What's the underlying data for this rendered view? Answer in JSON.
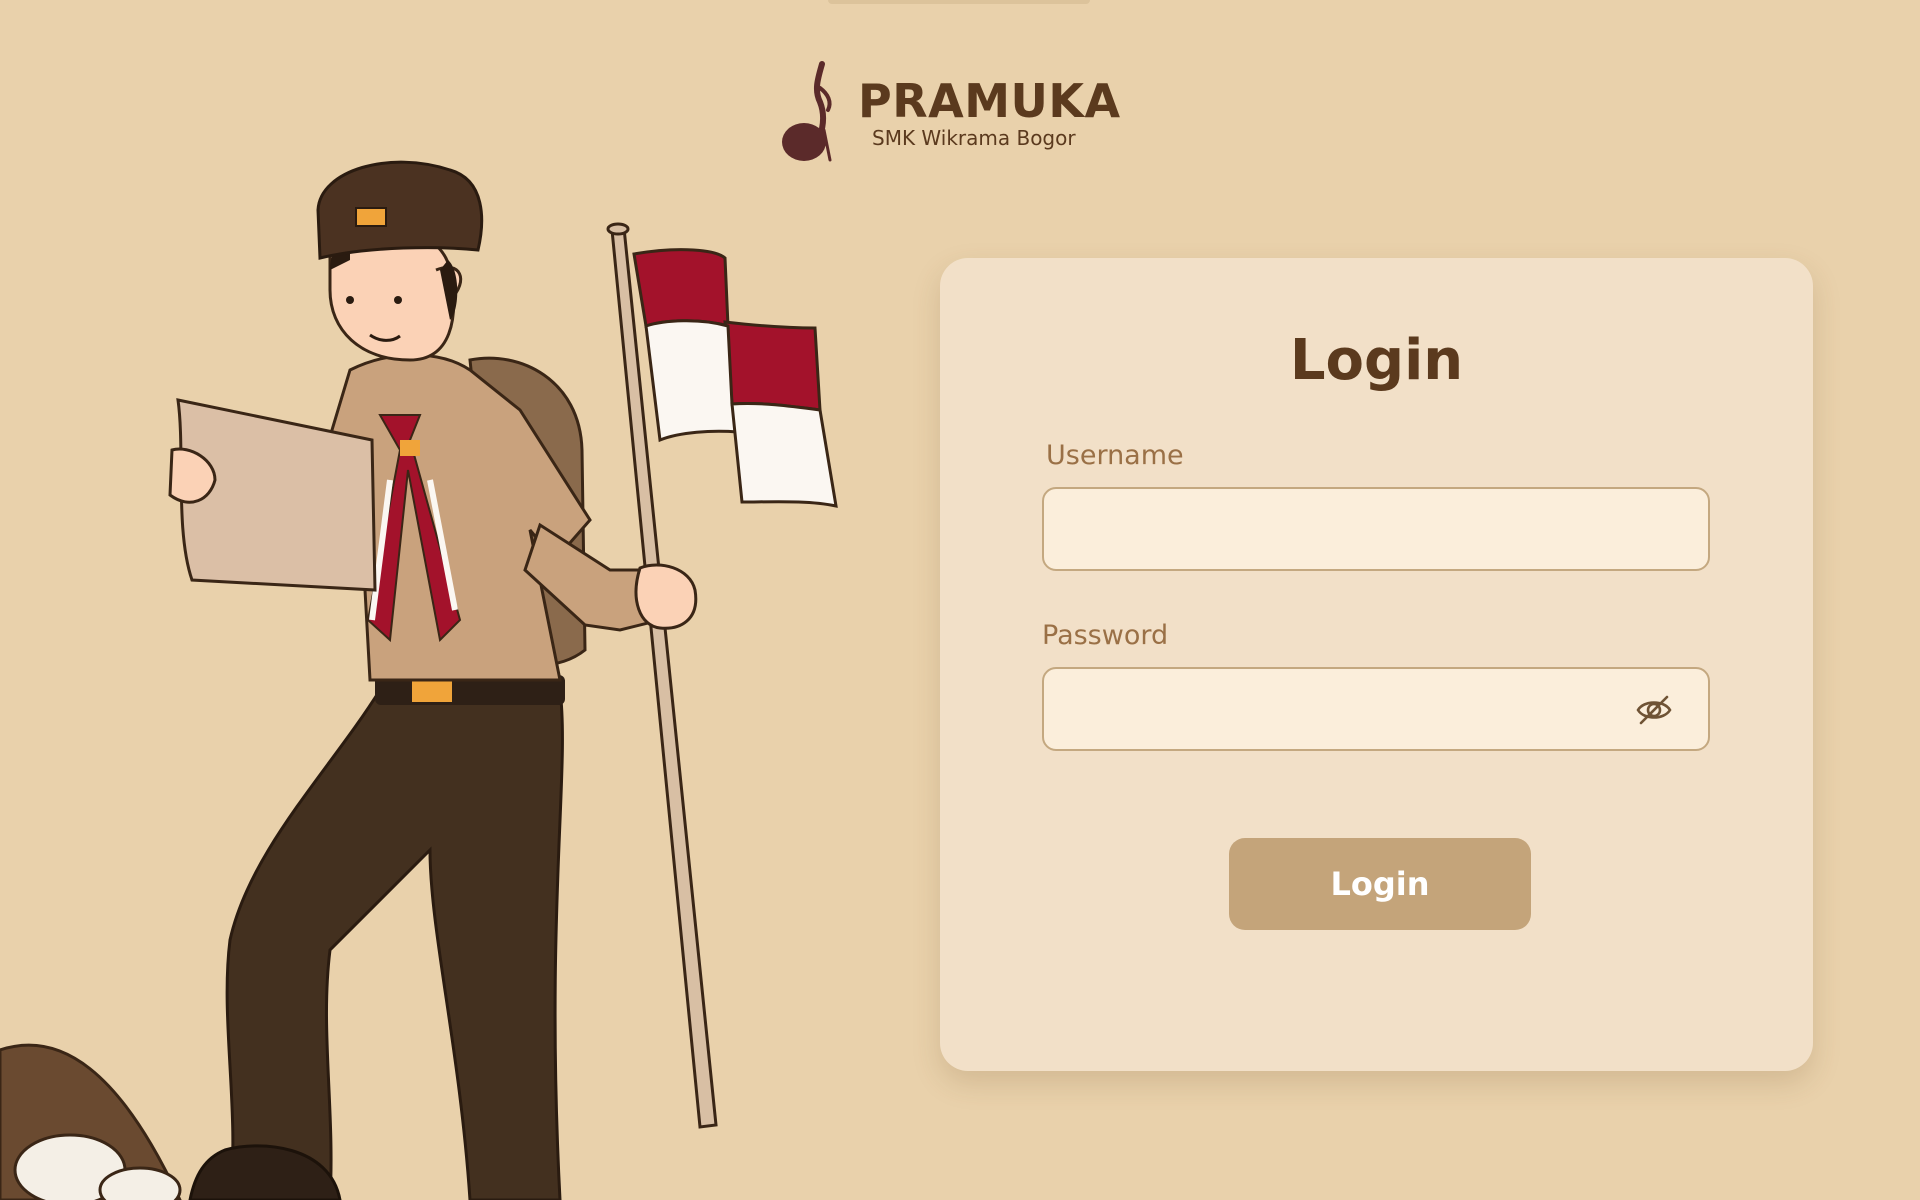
{
  "brand": {
    "name": "PRAMUKA",
    "subtitle": "SMK Wikrama Bogor",
    "logo_icon": "scout-fleur-logo-icon"
  },
  "illustration": {
    "description_icon": "scout-with-indonesian-flag-illustration"
  },
  "login": {
    "title": "Login",
    "username_label": "Username",
    "username_value": "",
    "username_placeholder": "",
    "password_label": "Password",
    "password_value": "",
    "password_placeholder": "",
    "password_toggle_icon": "eye-slash-icon",
    "submit_label": "Login"
  },
  "colors": {
    "background": "#e9d1ab",
    "card": "#f2e0c8",
    "input_bg": "#fbeedb",
    "input_border": "#c4a880",
    "primary_text": "#5b3a1e",
    "label_text": "#9a7046",
    "button": "#c4a47a",
    "flag_red": "#a3122b"
  }
}
